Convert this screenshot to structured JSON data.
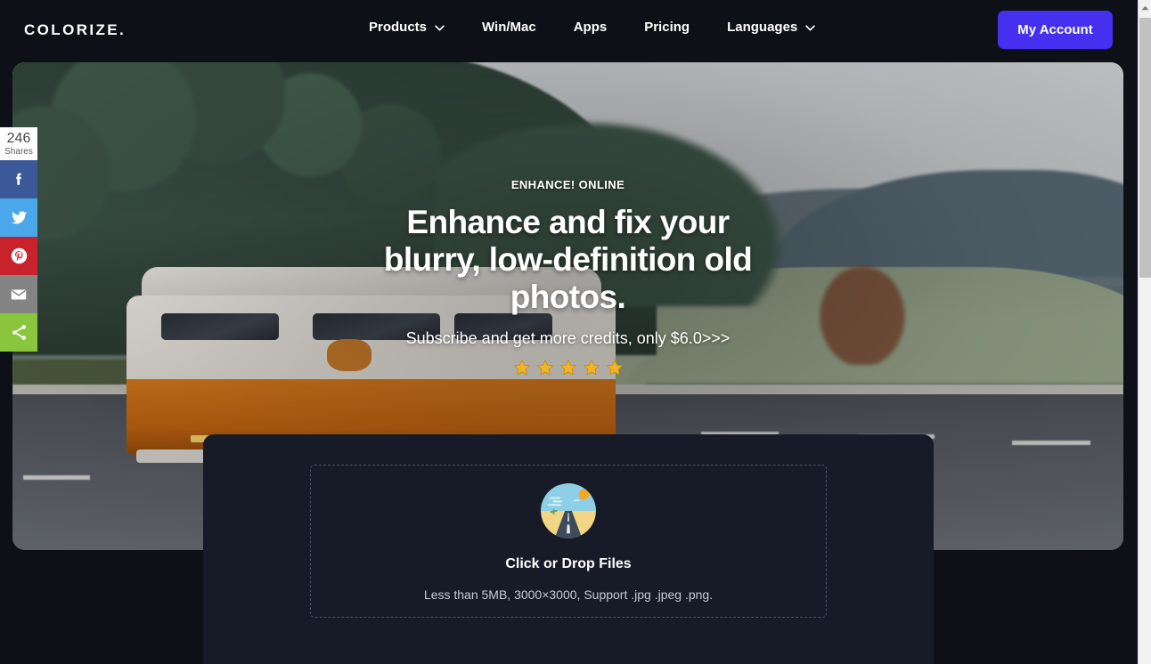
{
  "brand": {
    "logo_text": "COLORIZE."
  },
  "nav": {
    "items": [
      {
        "label": "Products",
        "has_chevron": true,
        "icon": "chevron-down-icon"
      },
      {
        "label": "Win/Mac",
        "has_chevron": false
      },
      {
        "label": "Apps",
        "has_chevron": false
      },
      {
        "label": "Pricing",
        "has_chevron": false
      },
      {
        "label": "Languages",
        "has_chevron": true,
        "icon": "chevron-down-icon"
      }
    ],
    "account_button": "My Account",
    "account_button_color": "#4530f0"
  },
  "hero": {
    "eyebrow": "ENHANCE! ONLINE",
    "headline": "Enhance and fix your blurry, low-definition old photos.",
    "subline": "Subscribe and get more credits, only $6.0>>>",
    "rating": 5,
    "star_color": "#f0b429",
    "background_description": "vintage orange VW campervan parked by a road with green hills"
  },
  "upload": {
    "title": "Click or Drop Files",
    "hint": "Less than 5MB, 3000×3000, Support .jpg .jpeg .png.",
    "illustration": "desert-road-image-icon",
    "card_color": "#161b27"
  },
  "share_rail": {
    "count": "246",
    "count_label": "Shares",
    "buttons": [
      {
        "name": "facebook-share-button",
        "icon": "facebook-icon",
        "color": "#3b5998"
      },
      {
        "name": "twitter-share-button",
        "icon": "twitter-icon",
        "color": "#4aa7ea"
      },
      {
        "name": "pinterest-share-button",
        "icon": "pinterest-icon",
        "color": "#c8232c"
      },
      {
        "name": "email-share-button",
        "icon": "envelope-icon",
        "color": "#848484"
      },
      {
        "name": "more-share-button",
        "icon": "share-nodes-icon",
        "color": "#8ac53e"
      }
    ]
  },
  "scrollbar": {
    "up_arrow": "scroll-up-arrow",
    "thumb_top_pct": 3,
    "thumb_height_pct": 39
  },
  "colors": {
    "page_background": "#0d1117",
    "accent": "#4530f0",
    "card": "#161b27"
  }
}
